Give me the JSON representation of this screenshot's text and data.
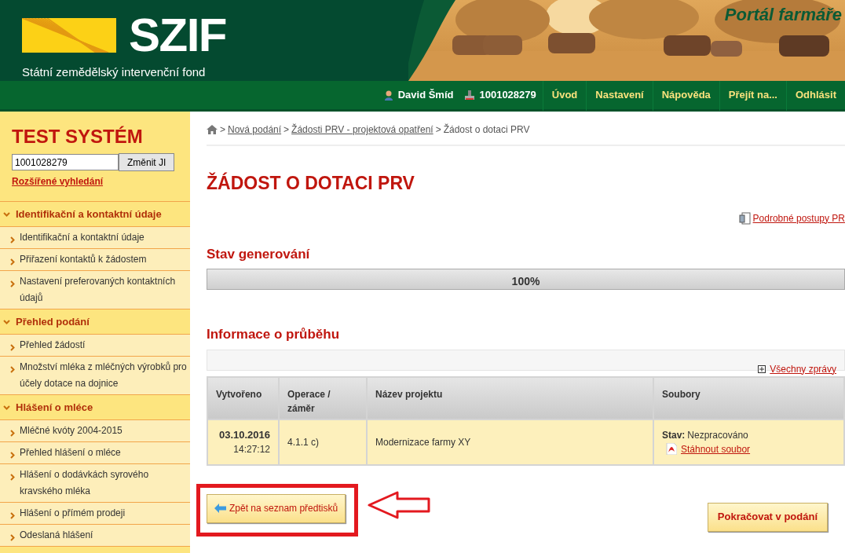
{
  "header": {
    "logo_text": "SZIF",
    "subtitle": "Státní zemědělský intervenční fond",
    "portal_title": "Portál farmáře"
  },
  "user_bar": {
    "user_name": "David Šmíd",
    "client_id": "1001028279",
    "links": [
      "Úvod",
      "Nastavení",
      "Nápověda",
      "Přejít na...",
      "Odhlásit"
    ]
  },
  "sidebar": {
    "title": "TEST SYSTÉM",
    "search": {
      "value": "1001028279"
    },
    "search_button": "Změnit JI",
    "advanced_search_link": "Rozšířené vyhledání",
    "sections": [
      {
        "label": "Identifikační a kontaktní údaje",
        "expanded": true,
        "items": [
          "Identifikační a kontaktní údaje",
          "Přiřazení kontaktů k žádostem",
          "Nastavení preferovaných kontaktních údajů"
        ]
      },
      {
        "label": "Přehled podání",
        "expanded": true,
        "items": [
          "Přehled žádostí",
          "Množství mléka z mléčných výrobků pro účely dotace na dojnice"
        ]
      },
      {
        "label": "Hlášení o mléce",
        "expanded": true,
        "items": [
          "Mléčné kvóty 2004-2015",
          "Přehled hlášení o mléce",
          "Hlášení o dodávkách syrového kravského mléka",
          "Hlášení o přímém prodeji",
          "Odeslaná hlášení"
        ]
      }
    ]
  },
  "breadcrumb": {
    "separator": ">",
    "items": [
      {
        "label": "Nová podání",
        "link": true
      },
      {
        "label": "Žádosti PRV - projektová opatření",
        "link": true
      },
      {
        "label": "Žádost o dotaci PRV",
        "link": false
      }
    ]
  },
  "page_title": "ŽÁDOST O DOTACI PRV",
  "procedures_link": "Podrobné postupy PR",
  "generation": {
    "heading": "Stav generování",
    "progress": {
      "level": 1,
      "reading": "100%"
    }
  },
  "progress_info": {
    "heading": "Informace o průběhu",
    "all_messages_link": "Všechny zprávy",
    "table": {
      "columns": [
        "Vytvořeno",
        "Operace / záměr",
        "Název projektu",
        "Soubory"
      ],
      "rows": [
        {
          "created_date": "03.10.2016",
          "created_time": "14:27:12",
          "operation": "4.1.1 c)",
          "project_name": "Modernizace farmy XY",
          "status_label": "Stav:",
          "status_value": "Nezpracováno",
          "download_link": "Stáhnout soubor"
        }
      ]
    }
  },
  "buttons": {
    "back": "Zpět na seznam předtisků",
    "continue": "Pokračovat v podání"
  }
}
